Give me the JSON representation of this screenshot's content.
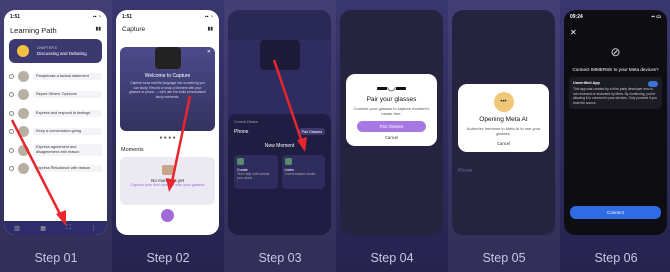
{
  "steps": [
    {
      "label": "Step 01",
      "status_time": "1:51",
      "title": "Learning Path",
      "chapter_label": "CHAPTER 5",
      "chapter_title": "Discussing and Debating",
      "items": [
        "Paraphrase a factual statement",
        "Report Others' Opinions",
        "Express and respond to feelings",
        "Keep a conversation going",
        "Express agreement and disagreement with reason",
        "Express Reluctance with reason"
      ]
    },
    {
      "label": "Step 02",
      "status_time": "1:51",
      "title": "Capture",
      "card_title": "Welcome to Capture",
      "card_text": "Capture turns real life language into something you can study. Record or snap a Moment with your glasses or phone — we'll use it to build personalized study moments.",
      "moments_title": "Moments",
      "empty_title": "No moments yet",
      "empty_text": "Capture your first moment with your glasses"
    },
    {
      "label": "Step 03",
      "section_label": "Current Device",
      "device": "Phone",
      "pair_label": "Pair Glasses",
      "new_moment": "New Moment",
      "tiles": [
        {
          "title": "Curate",
          "text": "Text help with words you need"
        },
        {
          "title": "Listen",
          "text": "Conversation audio"
        }
      ]
    },
    {
      "label": "Step 04",
      "modal_title": "Pair your glasses",
      "modal_text": "Connect your glasses to capture moment's hands-free.",
      "primary": "Pair Glasses",
      "secondary": "Cancel"
    },
    {
      "label": "Step 05",
      "modal_title": "Opening Meta AI",
      "modal_text": "Authorize Immerse in Meta AI to use your glasses.",
      "secondary": "Cancel",
      "bg_device": "Phone"
    },
    {
      "label": "Step 06",
      "status_time": "09:24",
      "question": "Connect IMMERSE to your Meta devices?",
      "warn_title": "Unverified App",
      "warn_text": "This app was created by a third party developer who is not reviewed or endorsed by Meta. By continuing, you're allowing it to connect to your devices. Only proceed if you trust the source.",
      "connect": "Connect"
    }
  ],
  "colors": {
    "background": "#2e2a5c",
    "accent": "#a778e3",
    "arrow": "#e8262c",
    "meta_blue": "#2f6be4"
  }
}
